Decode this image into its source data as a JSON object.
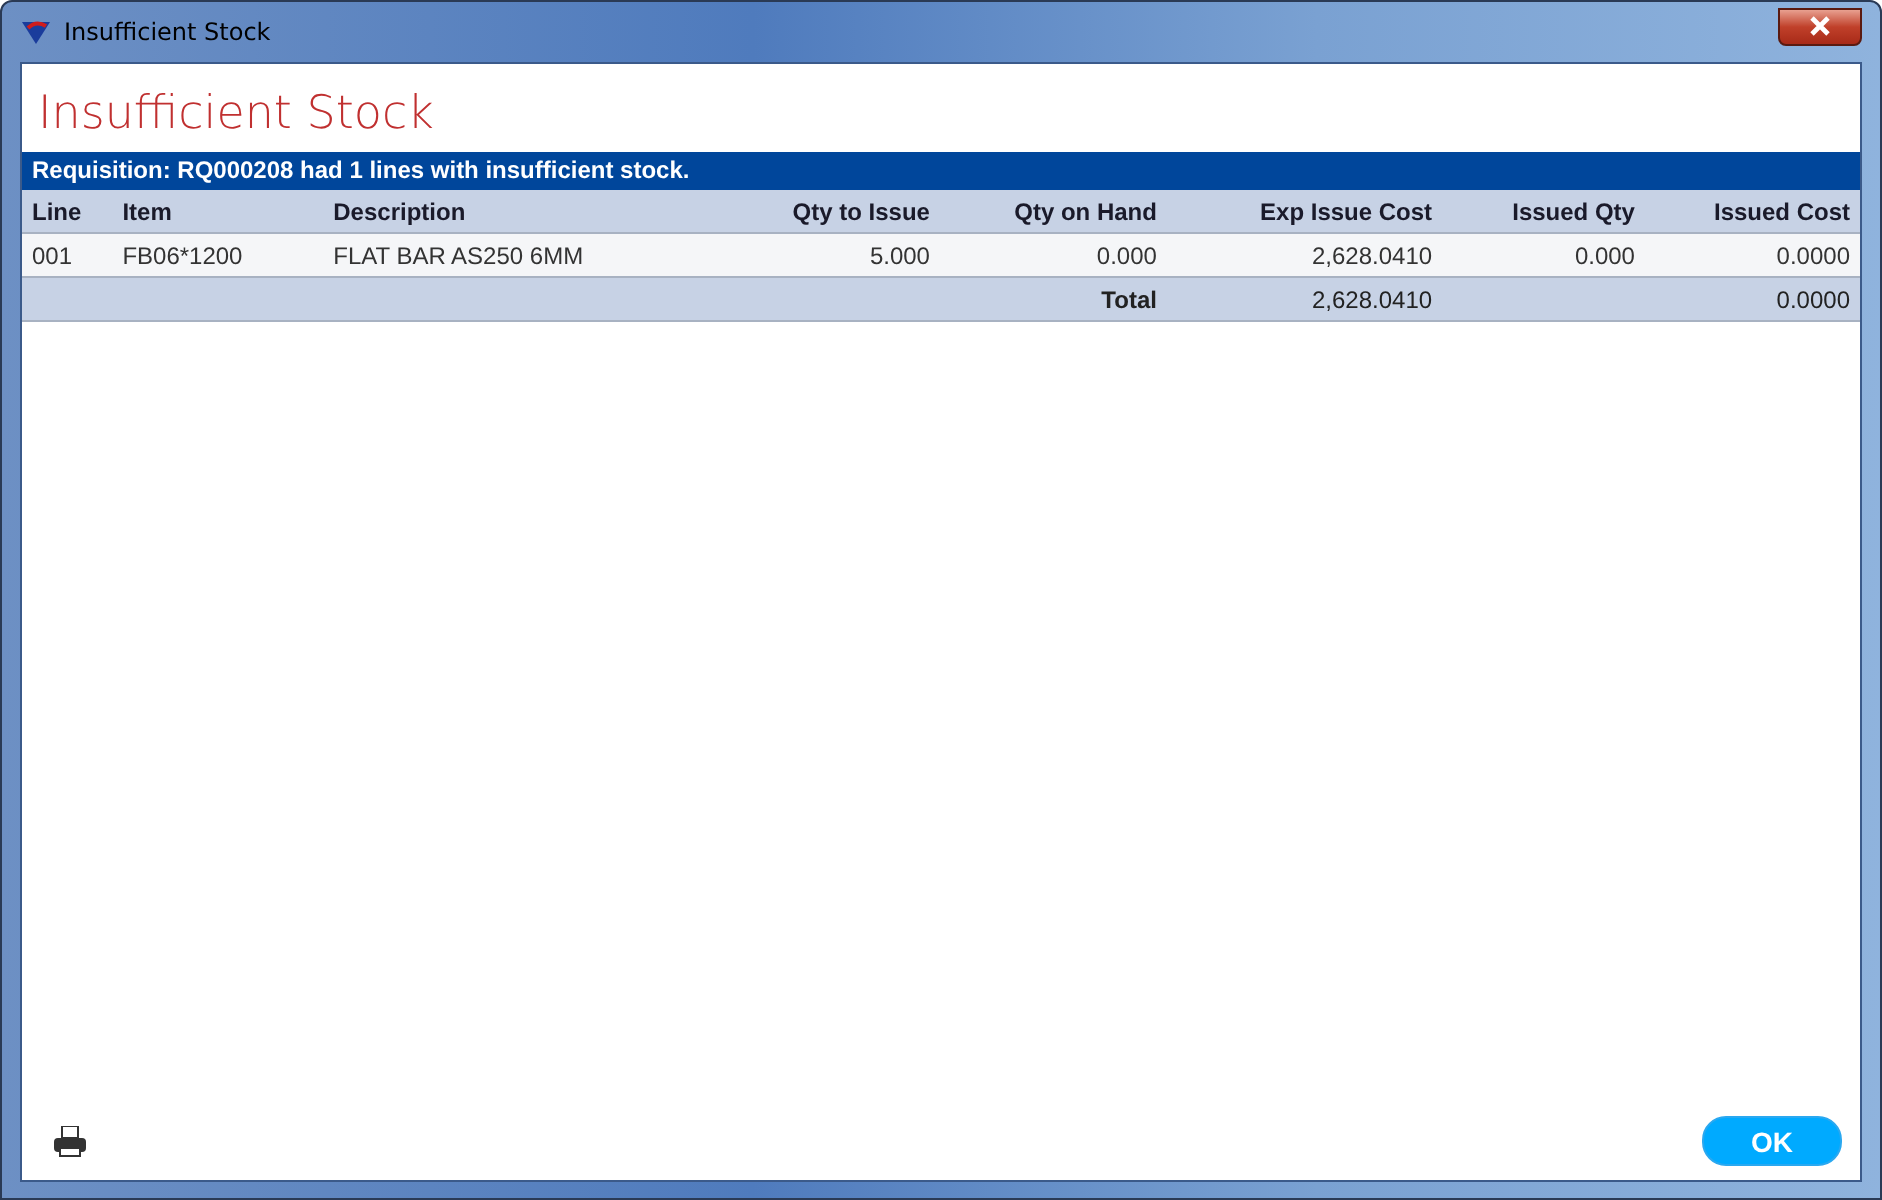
{
  "window": {
    "title": "Insufficient Stock"
  },
  "heading": "Insufficient Stock",
  "banner": "Requisition: RQ000208 had 1 lines with insufficient stock.",
  "table": {
    "columns": [
      "Line",
      "Item",
      "Description",
      "Qty to Issue",
      "Qty on Hand",
      "Exp Issue Cost",
      "Issued Qty",
      "Issued Cost"
    ],
    "rows": [
      {
        "cells": [
          "001",
          "FB06*1200",
          "FLAT BAR AS250 6MM",
          "5.000",
          "0.000",
          "2,628.0410",
          "0.000",
          "0.0000"
        ]
      }
    ],
    "total": {
      "label": "Total",
      "exp_issue_cost": "2,628.0410",
      "issued_cost": "0.0000"
    }
  },
  "buttons": [
    {
      "label": "OK"
    }
  ]
}
